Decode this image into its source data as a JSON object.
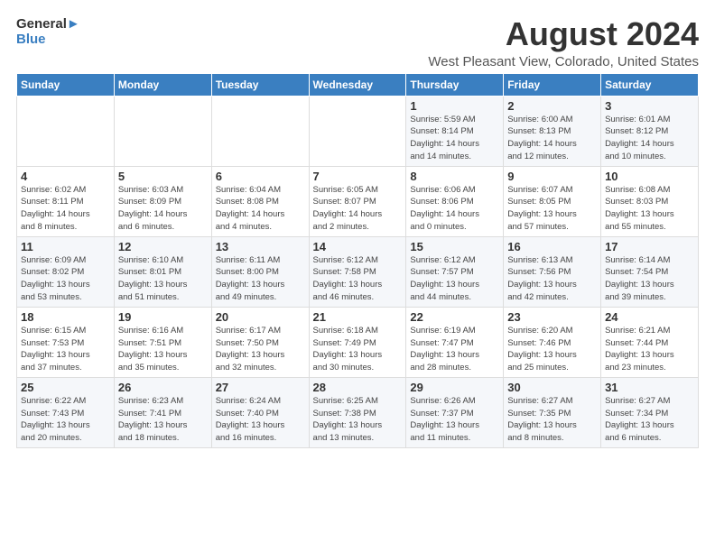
{
  "logo": {
    "general": "General",
    "blue": "Blue"
  },
  "title": "August 2024",
  "subtitle": "West Pleasant View, Colorado, United States",
  "headers": [
    "Sunday",
    "Monday",
    "Tuesday",
    "Wednesday",
    "Thursday",
    "Friday",
    "Saturday"
  ],
  "weeks": [
    [
      {
        "day": "",
        "info": ""
      },
      {
        "day": "",
        "info": ""
      },
      {
        "day": "",
        "info": ""
      },
      {
        "day": "",
        "info": ""
      },
      {
        "day": "1",
        "info": "Sunrise: 5:59 AM\nSunset: 8:14 PM\nDaylight: 14 hours\nand 14 minutes."
      },
      {
        "day": "2",
        "info": "Sunrise: 6:00 AM\nSunset: 8:13 PM\nDaylight: 14 hours\nand 12 minutes."
      },
      {
        "day": "3",
        "info": "Sunrise: 6:01 AM\nSunset: 8:12 PM\nDaylight: 14 hours\nand 10 minutes."
      }
    ],
    [
      {
        "day": "4",
        "info": "Sunrise: 6:02 AM\nSunset: 8:11 PM\nDaylight: 14 hours\nand 8 minutes."
      },
      {
        "day": "5",
        "info": "Sunrise: 6:03 AM\nSunset: 8:09 PM\nDaylight: 14 hours\nand 6 minutes."
      },
      {
        "day": "6",
        "info": "Sunrise: 6:04 AM\nSunset: 8:08 PM\nDaylight: 14 hours\nand 4 minutes."
      },
      {
        "day": "7",
        "info": "Sunrise: 6:05 AM\nSunset: 8:07 PM\nDaylight: 14 hours\nand 2 minutes."
      },
      {
        "day": "8",
        "info": "Sunrise: 6:06 AM\nSunset: 8:06 PM\nDaylight: 14 hours\nand 0 minutes."
      },
      {
        "day": "9",
        "info": "Sunrise: 6:07 AM\nSunset: 8:05 PM\nDaylight: 13 hours\nand 57 minutes."
      },
      {
        "day": "10",
        "info": "Sunrise: 6:08 AM\nSunset: 8:03 PM\nDaylight: 13 hours\nand 55 minutes."
      }
    ],
    [
      {
        "day": "11",
        "info": "Sunrise: 6:09 AM\nSunset: 8:02 PM\nDaylight: 13 hours\nand 53 minutes."
      },
      {
        "day": "12",
        "info": "Sunrise: 6:10 AM\nSunset: 8:01 PM\nDaylight: 13 hours\nand 51 minutes."
      },
      {
        "day": "13",
        "info": "Sunrise: 6:11 AM\nSunset: 8:00 PM\nDaylight: 13 hours\nand 49 minutes."
      },
      {
        "day": "14",
        "info": "Sunrise: 6:12 AM\nSunset: 7:58 PM\nDaylight: 13 hours\nand 46 minutes."
      },
      {
        "day": "15",
        "info": "Sunrise: 6:12 AM\nSunset: 7:57 PM\nDaylight: 13 hours\nand 44 minutes."
      },
      {
        "day": "16",
        "info": "Sunrise: 6:13 AM\nSunset: 7:56 PM\nDaylight: 13 hours\nand 42 minutes."
      },
      {
        "day": "17",
        "info": "Sunrise: 6:14 AM\nSunset: 7:54 PM\nDaylight: 13 hours\nand 39 minutes."
      }
    ],
    [
      {
        "day": "18",
        "info": "Sunrise: 6:15 AM\nSunset: 7:53 PM\nDaylight: 13 hours\nand 37 minutes."
      },
      {
        "day": "19",
        "info": "Sunrise: 6:16 AM\nSunset: 7:51 PM\nDaylight: 13 hours\nand 35 minutes."
      },
      {
        "day": "20",
        "info": "Sunrise: 6:17 AM\nSunset: 7:50 PM\nDaylight: 13 hours\nand 32 minutes."
      },
      {
        "day": "21",
        "info": "Sunrise: 6:18 AM\nSunset: 7:49 PM\nDaylight: 13 hours\nand 30 minutes."
      },
      {
        "day": "22",
        "info": "Sunrise: 6:19 AM\nSunset: 7:47 PM\nDaylight: 13 hours\nand 28 minutes."
      },
      {
        "day": "23",
        "info": "Sunrise: 6:20 AM\nSunset: 7:46 PM\nDaylight: 13 hours\nand 25 minutes."
      },
      {
        "day": "24",
        "info": "Sunrise: 6:21 AM\nSunset: 7:44 PM\nDaylight: 13 hours\nand 23 minutes."
      }
    ],
    [
      {
        "day": "25",
        "info": "Sunrise: 6:22 AM\nSunset: 7:43 PM\nDaylight: 13 hours\nand 20 minutes."
      },
      {
        "day": "26",
        "info": "Sunrise: 6:23 AM\nSunset: 7:41 PM\nDaylight: 13 hours\nand 18 minutes."
      },
      {
        "day": "27",
        "info": "Sunrise: 6:24 AM\nSunset: 7:40 PM\nDaylight: 13 hours\nand 16 minutes."
      },
      {
        "day": "28",
        "info": "Sunrise: 6:25 AM\nSunset: 7:38 PM\nDaylight: 13 hours\nand 13 minutes."
      },
      {
        "day": "29",
        "info": "Sunrise: 6:26 AM\nSunset: 7:37 PM\nDaylight: 13 hours\nand 11 minutes."
      },
      {
        "day": "30",
        "info": "Sunrise: 6:27 AM\nSunset: 7:35 PM\nDaylight: 13 hours\nand 8 minutes."
      },
      {
        "day": "31",
        "info": "Sunrise: 6:27 AM\nSunset: 7:34 PM\nDaylight: 13 hours\nand 6 minutes."
      }
    ]
  ]
}
